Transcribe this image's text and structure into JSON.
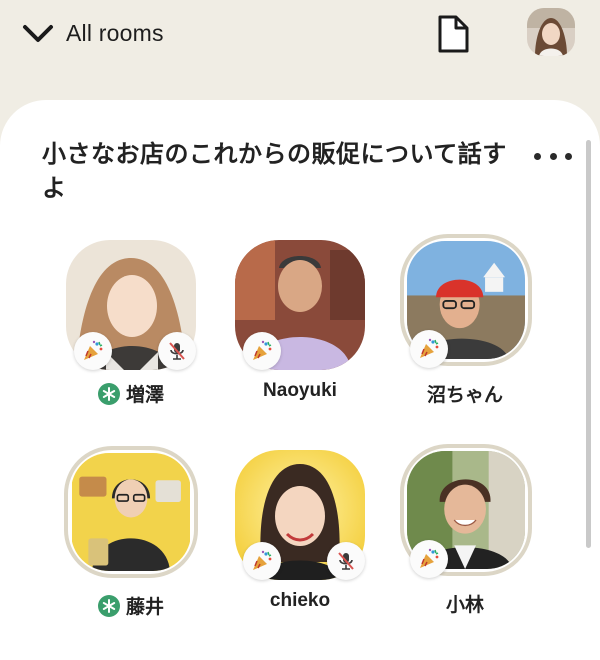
{
  "header": {
    "back_label": "All rooms",
    "back_icon": "chevron-down-icon",
    "document_icon": "document-icon"
  },
  "room": {
    "title": "小さなお店のこれからの販促について話すよ"
  },
  "speakers": [
    {
      "name": "増澤",
      "moderator": true,
      "muted": true,
      "ring": false
    },
    {
      "name": "Naoyuki",
      "moderator": false,
      "muted": false,
      "ring": false
    },
    {
      "name": "沼ちゃん",
      "moderator": false,
      "muted": false,
      "ring": true
    },
    {
      "name": "藤井",
      "moderator": true,
      "muted": false,
      "ring": true
    },
    {
      "name": "chieko",
      "moderator": false,
      "muted": true,
      "ring": false
    },
    {
      "name": "小林",
      "moderator": false,
      "muted": false,
      "ring": true
    }
  ],
  "colors": {
    "background": "#f0ede4",
    "card": "#ffffff",
    "moderator_green": "#3a9e6c",
    "mute_red": "#d9534f",
    "speaking_ring": "#dcd6c6"
  }
}
